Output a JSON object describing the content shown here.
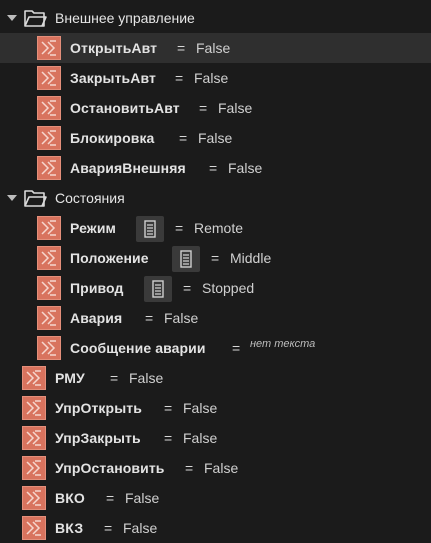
{
  "colors": {
    "background": "#1b1b1b",
    "selected_row": "#2f2f2f",
    "variable_icon": "#d8735e",
    "text": "#e3e3e3"
  },
  "tree": {
    "groups": [
      {
        "label": "Внешнее управление",
        "icon": "folder-icon",
        "expanded": true,
        "items": [
          {
            "name": "ОткрытьАвт",
            "eq": "=",
            "value": "False",
            "selected": true
          },
          {
            "name": "ЗакрытьАвт",
            "eq": "=",
            "value": "False"
          },
          {
            "name": "ОстановитьАвт",
            "eq": "=",
            "value": "False"
          },
          {
            "name": "Блокировка",
            "eq": "=",
            "value": "False"
          },
          {
            "name": "АварияВнешняя",
            "eq": "=",
            "value": "False"
          }
        ]
      },
      {
        "label": "Состояния",
        "icon": "folder-icon",
        "expanded": true,
        "items": [
          {
            "name": "Режим",
            "eq": "=",
            "value": "Remote",
            "enum": true
          },
          {
            "name": "Положение",
            "eq": "=",
            "value": "Middle",
            "enum": true
          },
          {
            "name": "Привод",
            "eq": "=",
            "value": "Stopped",
            "enum": true
          },
          {
            "name": "Авария",
            "eq": "=",
            "value": "False"
          },
          {
            "name": "Сообщение аварии",
            "eq": "=",
            "value": "нет текста",
            "empty": true
          }
        ]
      }
    ],
    "root_items": [
      {
        "name": "РМУ",
        "eq": "=",
        "value": "False"
      },
      {
        "name": "УпрОткрыть",
        "eq": "=",
        "value": "False"
      },
      {
        "name": "УпрЗакрыть",
        "eq": "=",
        "value": "False"
      },
      {
        "name": "УпрОстановить",
        "eq": "=",
        "value": "False"
      },
      {
        "name": "ВКО",
        "eq": "=",
        "value": "False"
      },
      {
        "name": "ВКЗ",
        "eq": "=",
        "value": "False"
      }
    ]
  }
}
